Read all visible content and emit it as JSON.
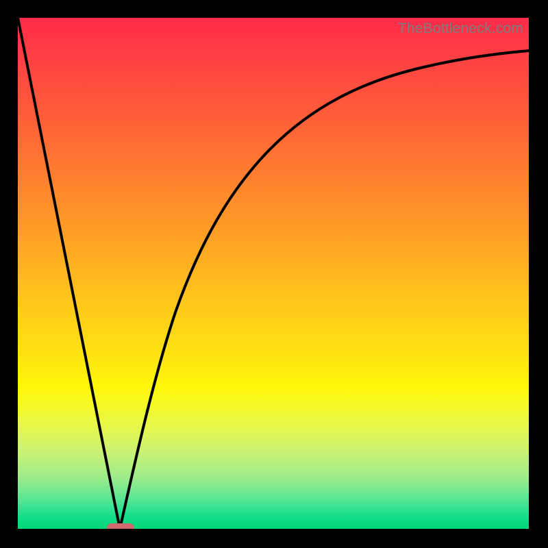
{
  "watermark": "TheBottleneck.com",
  "chart_data": {
    "type": "line",
    "title": "",
    "xlabel": "",
    "ylabel": "",
    "xlim": [
      0,
      100
    ],
    "ylim": [
      0,
      100
    ],
    "grid": false,
    "legend": false,
    "series": [
      {
        "name": "left-descending-line",
        "x": [
          0,
          20
        ],
        "y": [
          100,
          0
        ]
      },
      {
        "name": "right-rising-curve",
        "x": [
          20,
          25,
          30,
          35,
          40,
          45,
          50,
          55,
          60,
          65,
          70,
          75,
          80,
          85,
          90,
          95,
          100
        ],
        "y": [
          0,
          22,
          40,
          53,
          63,
          70,
          75,
          79,
          82,
          84.5,
          86.5,
          88,
          89.2,
          90.2,
          91,
          91.7,
          92.3
        ]
      }
    ],
    "marker": {
      "x": 20,
      "y": 0,
      "color": "#cf6a6e"
    },
    "background_gradient": {
      "top": "#ff2a4a",
      "mid1": "#ff9e26",
      "mid2": "#ffe312",
      "mid3": "#9cec8a",
      "bottom": "#00d776"
    }
  }
}
